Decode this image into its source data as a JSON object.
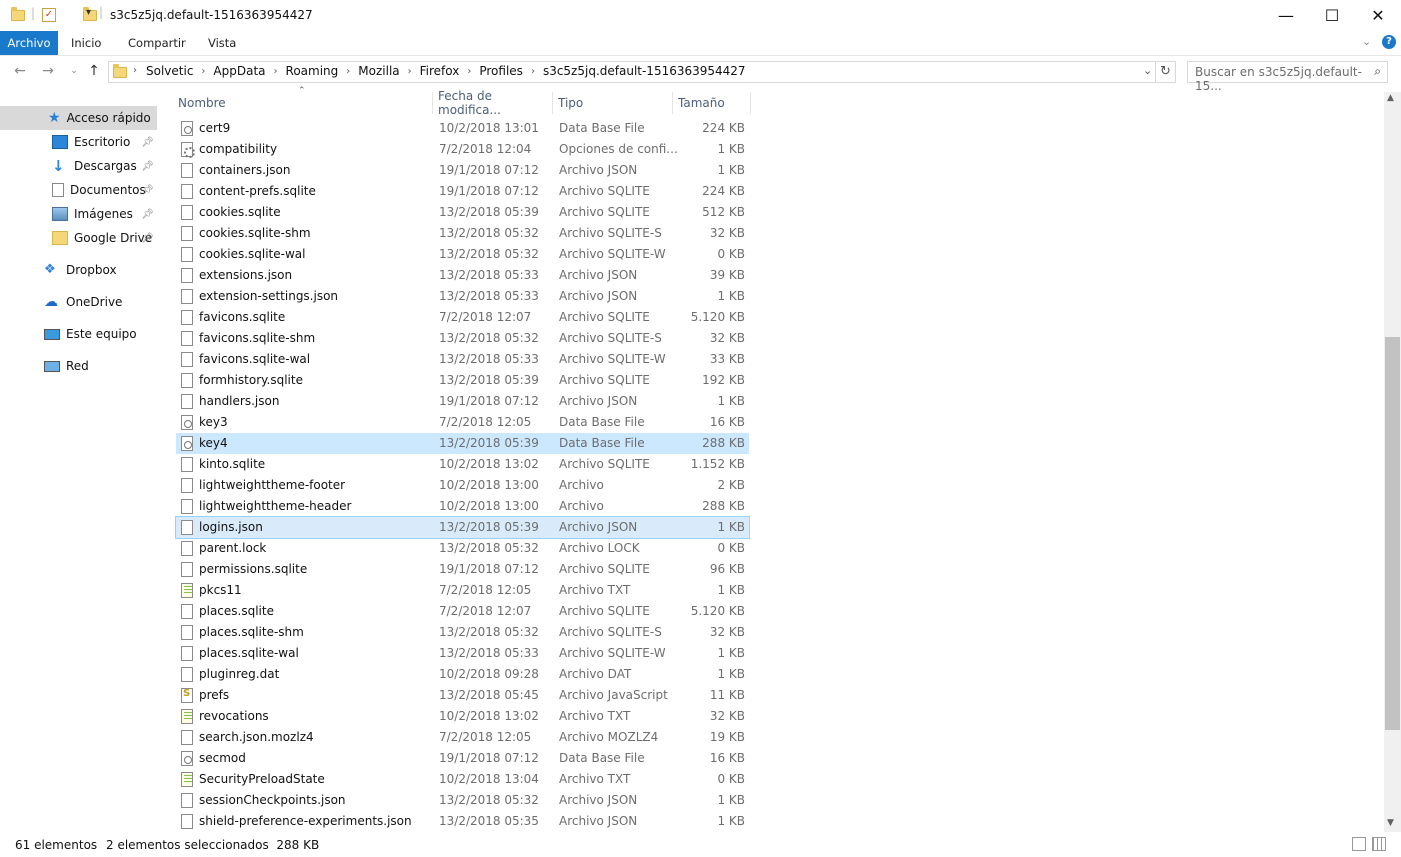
{
  "window": {
    "title": "s3c5z5jq.default-1516363954427",
    "minimize": "—",
    "maximize": "☐",
    "close": "✕"
  },
  "ribbon": {
    "tabs": [
      "Archivo",
      "Inicio",
      "Compartir",
      "Vista"
    ]
  },
  "address": {
    "crumbs": [
      "Solvetic",
      "AppData",
      "Roaming",
      "Mozilla",
      "Firefox",
      "Profiles",
      "s3c5z5jq.default-1516363954427"
    ],
    "search_placeholder": "Buscar en s3c5z5jq.default-15..."
  },
  "sidebar": {
    "items": [
      {
        "label": "Acceso rápido",
        "icon": "star-icon"
      },
      {
        "label": "Escritorio",
        "icon": "desktop-icon",
        "pinned": true
      },
      {
        "label": "Descargas",
        "icon": "download-icon",
        "pinned": true
      },
      {
        "label": "Documentos",
        "icon": "documents-icon",
        "pinned": true
      },
      {
        "label": "Imágenes",
        "icon": "pictures-icon",
        "pinned": true
      },
      {
        "label": "Google Drive",
        "icon": "folder-icon",
        "pinned": true
      },
      {
        "label": "Dropbox",
        "icon": "dropbox-icon"
      },
      {
        "label": "OneDrive",
        "icon": "cloud-icon"
      },
      {
        "label": "Este equipo",
        "icon": "computer-icon"
      },
      {
        "label": "Red",
        "icon": "network-icon"
      }
    ]
  },
  "columns": {
    "name": "Nombre",
    "date": "Fecha de modifica...",
    "type": "Tipo",
    "size": "Tamaño"
  },
  "files": [
    {
      "name": "cert9",
      "date": "10/2/2018 13:01",
      "type": "Data Base File",
      "size": "224 KB",
      "icon": "db"
    },
    {
      "name": "compatibility",
      "date": "7/2/2018 12:04",
      "type": "Opciones de confi...",
      "size": "1 KB",
      "icon": "cfg"
    },
    {
      "name": "containers.json",
      "date": "19/1/2018 07:12",
      "type": "Archivo JSON",
      "size": "1 KB",
      "icon": "file"
    },
    {
      "name": "content-prefs.sqlite",
      "date": "19/1/2018 07:12",
      "type": "Archivo SQLITE",
      "size": "224 KB",
      "icon": "file"
    },
    {
      "name": "cookies.sqlite",
      "date": "13/2/2018 05:39",
      "type": "Archivo SQLITE",
      "size": "512 KB",
      "icon": "file"
    },
    {
      "name": "cookies.sqlite-shm",
      "date": "13/2/2018 05:32",
      "type": "Archivo SQLITE-S",
      "size": "32 KB",
      "icon": "file"
    },
    {
      "name": "cookies.sqlite-wal",
      "date": "13/2/2018 05:32",
      "type": "Archivo SQLITE-W",
      "size": "0 KB",
      "icon": "file"
    },
    {
      "name": "extensions.json",
      "date": "13/2/2018 05:33",
      "type": "Archivo JSON",
      "size": "39 KB",
      "icon": "file"
    },
    {
      "name": "extension-settings.json",
      "date": "13/2/2018 05:33",
      "type": "Archivo JSON",
      "size": "1 KB",
      "icon": "file"
    },
    {
      "name": "favicons.sqlite",
      "date": "7/2/2018 12:07",
      "type": "Archivo SQLITE",
      "size": "5.120 KB",
      "icon": "file"
    },
    {
      "name": "favicons.sqlite-shm",
      "date": "13/2/2018 05:32",
      "type": "Archivo SQLITE-S",
      "size": "32 KB",
      "icon": "file"
    },
    {
      "name": "favicons.sqlite-wal",
      "date": "13/2/2018 05:33",
      "type": "Archivo SQLITE-W",
      "size": "33 KB",
      "icon": "file"
    },
    {
      "name": "formhistory.sqlite",
      "date": "13/2/2018 05:39",
      "type": "Archivo SQLITE",
      "size": "192 KB",
      "icon": "file"
    },
    {
      "name": "handlers.json",
      "date": "19/1/2018 07:12",
      "type": "Archivo JSON",
      "size": "1 KB",
      "icon": "file"
    },
    {
      "name": "key3",
      "date": "7/2/2018 12:05",
      "type": "Data Base File",
      "size": "16 KB",
      "icon": "db"
    },
    {
      "name": "key4",
      "date": "13/2/2018 05:39",
      "type": "Data Base File",
      "size": "288 KB",
      "icon": "db",
      "selected": true
    },
    {
      "name": "kinto.sqlite",
      "date": "10/2/2018 13:02",
      "type": "Archivo SQLITE",
      "size": "1.152 KB",
      "icon": "file"
    },
    {
      "name": "lightweighttheme-footer",
      "date": "10/2/2018 13:00",
      "type": "Archivo",
      "size": "2 KB",
      "icon": "file"
    },
    {
      "name": "lightweighttheme-header",
      "date": "10/2/2018 13:00",
      "type": "Archivo",
      "size": "288 KB",
      "icon": "file"
    },
    {
      "name": "logins.json",
      "date": "13/2/2018 05:39",
      "type": "Archivo JSON",
      "size": "1 KB",
      "icon": "file",
      "selected": true,
      "focused": true
    },
    {
      "name": "parent.lock",
      "date": "13/2/2018 05:32",
      "type": "Archivo LOCK",
      "size": "0 KB",
      "icon": "file"
    },
    {
      "name": "permissions.sqlite",
      "date": "19/1/2018 07:12",
      "type": "Archivo SQLITE",
      "size": "96 KB",
      "icon": "file"
    },
    {
      "name": "pkcs11",
      "date": "7/2/2018 12:05",
      "type": "Archivo TXT",
      "size": "1 KB",
      "icon": "txt"
    },
    {
      "name": "places.sqlite",
      "date": "7/2/2018 12:07",
      "type": "Archivo SQLITE",
      "size": "5.120 KB",
      "icon": "file"
    },
    {
      "name": "places.sqlite-shm",
      "date": "13/2/2018 05:32",
      "type": "Archivo SQLITE-S",
      "size": "32 KB",
      "icon": "file"
    },
    {
      "name": "places.sqlite-wal",
      "date": "13/2/2018 05:33",
      "type": "Archivo SQLITE-W",
      "size": "1 KB",
      "icon": "file"
    },
    {
      "name": "pluginreg.dat",
      "date": "10/2/2018 09:28",
      "type": "Archivo DAT",
      "size": "1 KB",
      "icon": "file"
    },
    {
      "name": "prefs",
      "date": "13/2/2018 05:45",
      "type": "Archivo JavaScript",
      "size": "11 KB",
      "icon": "js"
    },
    {
      "name": "revocations",
      "date": "10/2/2018 13:02",
      "type": "Archivo TXT",
      "size": "32 KB",
      "icon": "txt"
    },
    {
      "name": "search.json.mozlz4",
      "date": "7/2/2018 12:05",
      "type": "Archivo MOZLZ4",
      "size": "19 KB",
      "icon": "file"
    },
    {
      "name": "secmod",
      "date": "19/1/2018 07:12",
      "type": "Data Base File",
      "size": "16 KB",
      "icon": "db"
    },
    {
      "name": "SecurityPreloadState",
      "date": "10/2/2018 13:04",
      "type": "Archivo TXT",
      "size": "0 KB",
      "icon": "txt"
    },
    {
      "name": "sessionCheckpoints.json",
      "date": "13/2/2018 05:32",
      "type": "Archivo JSON",
      "size": "1 KB",
      "icon": "file"
    },
    {
      "name": "shield-preference-experiments.json",
      "date": "13/2/2018 05:35",
      "type": "Archivo JSON",
      "size": "1 KB",
      "icon": "file"
    }
  ],
  "status": {
    "count": "61 elementos",
    "selection": "2 elementos seleccionados  288 KB"
  },
  "colors": {
    "accent": "#1979ca",
    "selection": "#cce8ff"
  }
}
